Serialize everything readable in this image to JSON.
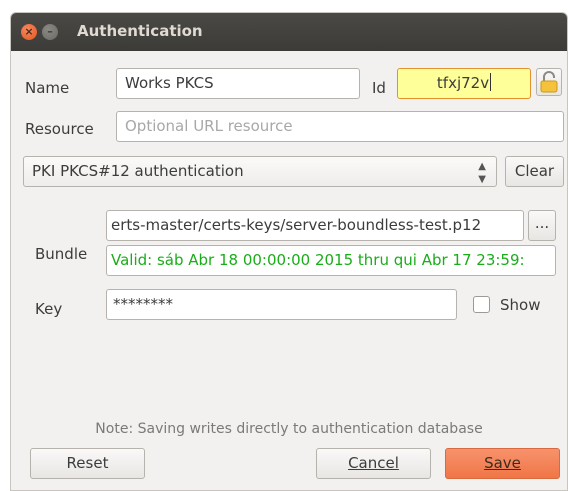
{
  "window": {
    "title": "Authentication"
  },
  "name": {
    "label": "Name",
    "value": "Works PKCS"
  },
  "id": {
    "label": "Id",
    "value": "tfxj72v"
  },
  "resource": {
    "label": "Resource",
    "placeholder": "Optional URL resource"
  },
  "method": {
    "selected": "PKI PKCS#12 authentication",
    "clear_label": "Clear"
  },
  "bundle": {
    "label": "Bundle",
    "path": "erts-master/certs-keys/server-boundless-test.p12",
    "browse_label": "...",
    "validity": "Valid: sáb Abr 18 00:00:00 2015 thru qui Abr 17 23:59:"
  },
  "key": {
    "label": "Key",
    "value": "********",
    "show_label": "Show"
  },
  "note": "Note: Saving writes directly to authentication database",
  "buttons": {
    "reset": "Reset",
    "cancel": "Cancel",
    "save": "Save"
  },
  "colors": {
    "save_accent": "#f07646",
    "id_highlight": "#ffff99",
    "valid_text": "#1aad19"
  }
}
